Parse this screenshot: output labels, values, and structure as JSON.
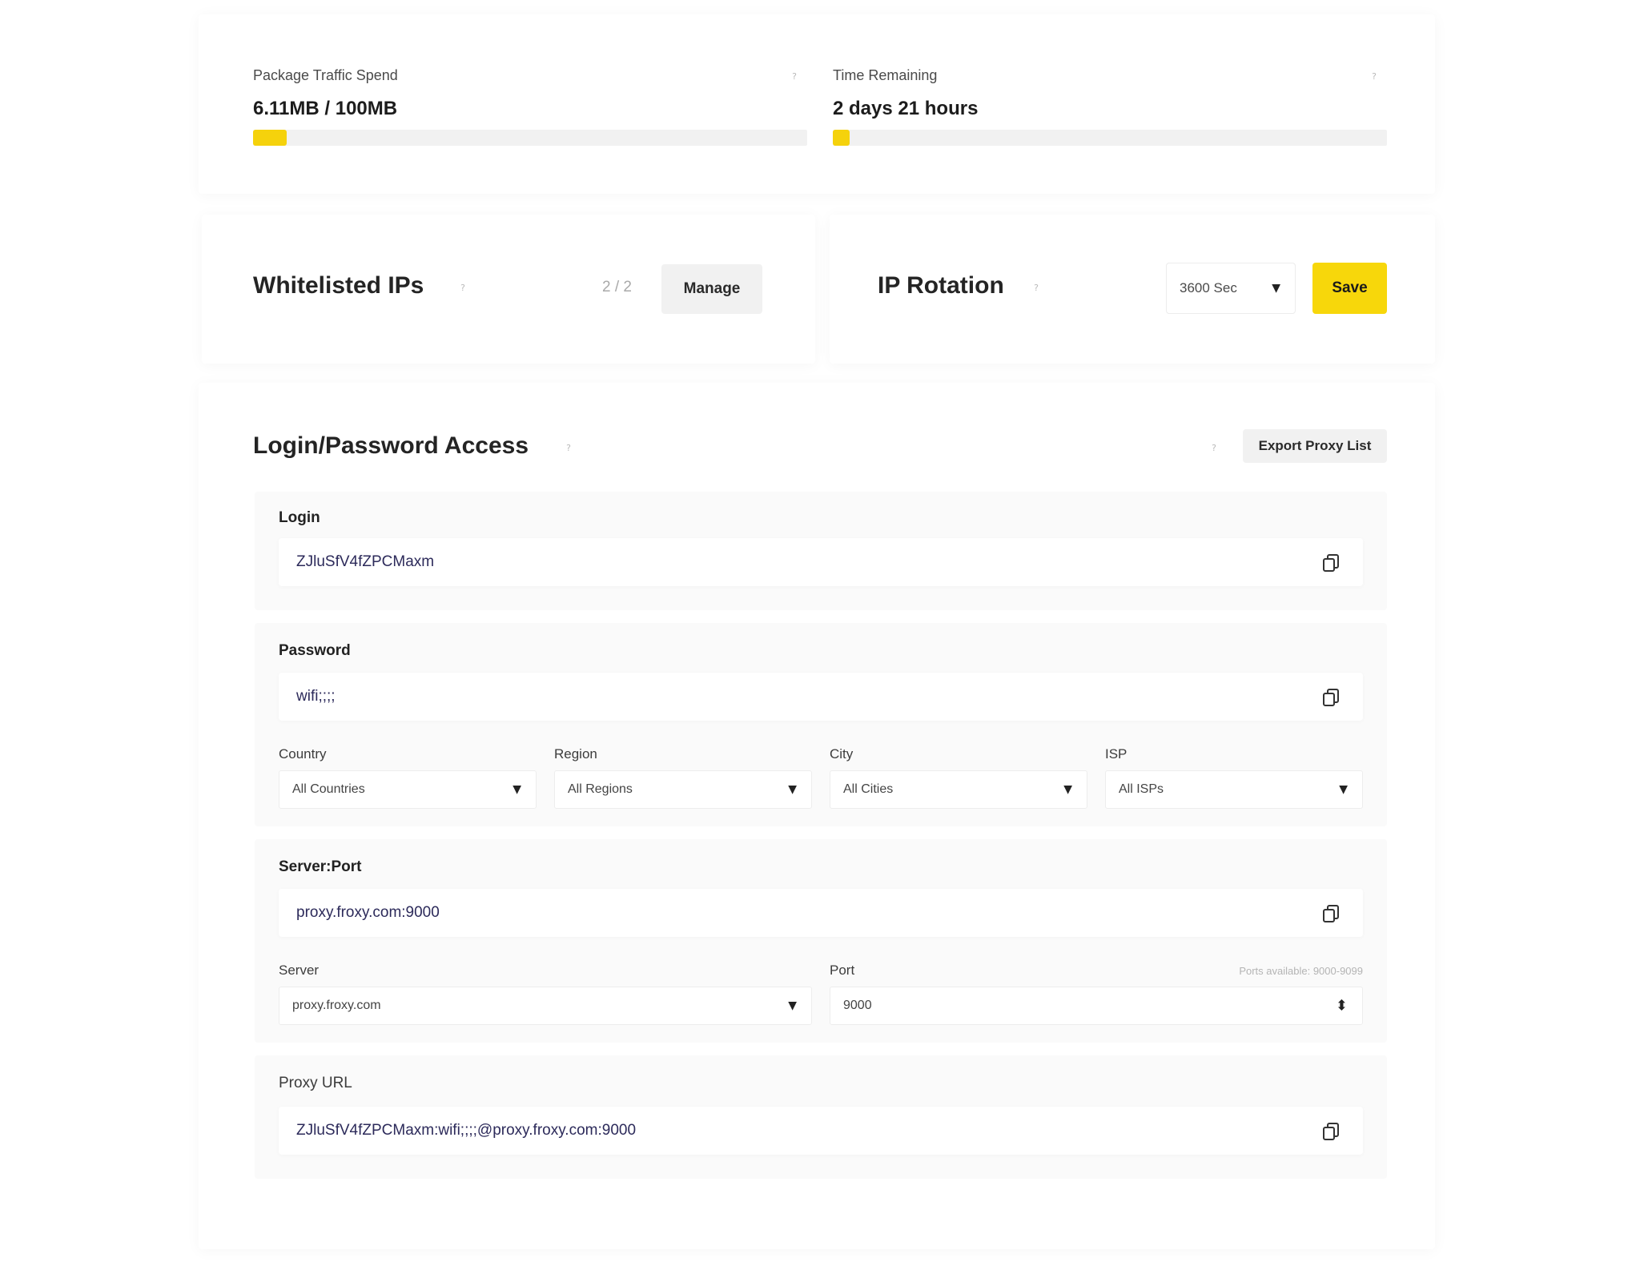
{
  "traffic": {
    "label": "Package Traffic Spend",
    "value": "6.11MB / 100MB",
    "progress_fraction": 0.0611
  },
  "time": {
    "label": "Time Remaining",
    "value": "2 days 21 hours",
    "progress_fraction": 0.03
  },
  "help_glyph": "?",
  "whitelisted": {
    "title": "Whitelisted IPs",
    "count": "2 / 2",
    "manage_label": "Manage"
  },
  "rotation": {
    "title": "IP Rotation",
    "interval": "3600 Sec",
    "save_label": "Save"
  },
  "access": {
    "title": "Login/Password Access",
    "export_label": "Export Proxy List",
    "login_label": "Login",
    "login_value": "ZJluSfV4fZPCMaxm",
    "password_label": "Password",
    "password_value": "wifi;;;;",
    "filters": {
      "country_label": "Country",
      "country_value": "All Countries",
      "region_label": "Region",
      "region_value": "All Regions",
      "city_label": "City",
      "city_value": "All Cities",
      "isp_label": "ISP",
      "isp_value": "All ISPs"
    },
    "server_port_label": "Server:Port",
    "server_port_value": "proxy.froxy.com:9000",
    "server_label": "Server",
    "server_value": "proxy.froxy.com",
    "port_label": "Port",
    "port_value": "9000",
    "ports_hint": "Ports available: 9000-9099",
    "proxy_url_label": "Proxy URL",
    "proxy_url_value": "ZJluSfV4fZPCMaxm:wifi;;;;@proxy.froxy.com:9000"
  },
  "glyphs": {
    "caret": "▼",
    "stepper": "⬍"
  },
  "icons": {
    "help": "question-mark-icon",
    "copy": "copy-icon",
    "dropdown": "chevron-down-icon"
  },
  "colors": {
    "accent": "#f7d70b",
    "value_text": "#2c2a5a",
    "panel_bg": "#fafafa"
  }
}
